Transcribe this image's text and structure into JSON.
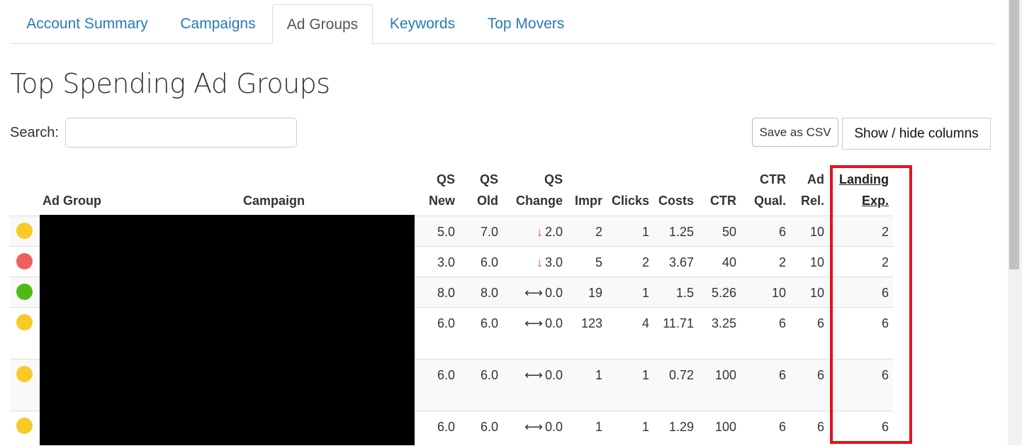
{
  "tabs": [
    {
      "label": "Account Summary",
      "active": false
    },
    {
      "label": "Campaigns",
      "active": false
    },
    {
      "label": "Ad Groups",
      "active": true
    },
    {
      "label": "Keywords",
      "active": false
    },
    {
      "label": "Top Movers",
      "active": false
    }
  ],
  "page_title": "Top Spending Ad Groups",
  "search": {
    "label": "Search:",
    "value": "",
    "placeholder": ""
  },
  "buttons": {
    "save_csv": "Save as CSV",
    "show_hide": "Show / hide columns"
  },
  "columns": {
    "ad_group": "Ad Group",
    "campaign": "Campaign",
    "qs_new": [
      "QS",
      "New"
    ],
    "qs_old": [
      "QS",
      "Old"
    ],
    "qs_change": [
      "QS",
      "Change"
    ],
    "impr": "Impr",
    "clicks": "Clicks",
    "costs": "Costs",
    "ctr": "CTR",
    "ctr_qual": [
      "CTR",
      "Qual."
    ],
    "ad_rel": [
      "Ad",
      "Rel."
    ],
    "landing_exp": [
      "Landing",
      "Exp."
    ]
  },
  "status_colors": {
    "yellow": "#f9c928",
    "red": "#f0605a",
    "green": "#4cbb17"
  },
  "redaction_color": "#000000",
  "highlight_color": "#e0141e",
  "rows": [
    {
      "status": "yellow",
      "qs_new": "5.0",
      "qs_old": "7.0",
      "change_dir": "down",
      "qs_change": "2.0",
      "impr": "2",
      "clicks": "1",
      "costs": "1.25",
      "ctr": "50",
      "ctr_qual": "6",
      "ad_rel": "10",
      "landing_exp": "2"
    },
    {
      "status": "red",
      "qs_new": "3.0",
      "qs_old": "6.0",
      "change_dir": "down",
      "qs_change": "3.0",
      "impr": "5",
      "clicks": "2",
      "costs": "3.67",
      "ctr": "40",
      "ctr_qual": "2",
      "ad_rel": "10",
      "landing_exp": "2"
    },
    {
      "status": "green",
      "qs_new": "8.0",
      "qs_old": "8.0",
      "change_dir": "same",
      "qs_change": "0.0",
      "impr": "19",
      "clicks": "1",
      "costs": "1.5",
      "ctr": "5.26",
      "ctr_qual": "10",
      "ad_rel": "10",
      "landing_exp": "6"
    },
    {
      "status": "yellow",
      "qs_new": "6.0",
      "qs_old": "6.0",
      "change_dir": "same",
      "qs_change": "0.0",
      "impr": "123",
      "clicks": "4",
      "costs": "11.71",
      "ctr": "3.25",
      "ctr_qual": "6",
      "ad_rel": "6",
      "landing_exp": "6"
    },
    {
      "status": "yellow",
      "qs_new": "6.0",
      "qs_old": "6.0",
      "change_dir": "same",
      "qs_change": "0.0",
      "impr": "1",
      "clicks": "1",
      "costs": "0.72",
      "ctr": "100",
      "ctr_qual": "6",
      "ad_rel": "6",
      "landing_exp": "6"
    },
    {
      "status": "yellow",
      "qs_new": "6.0",
      "qs_old": "6.0",
      "change_dir": "same",
      "qs_change": "0.0",
      "impr": "1",
      "clicks": "1",
      "costs": "1.29",
      "ctr": "100",
      "ctr_qual": "6",
      "ad_rel": "6",
      "landing_exp": "6"
    }
  ]
}
